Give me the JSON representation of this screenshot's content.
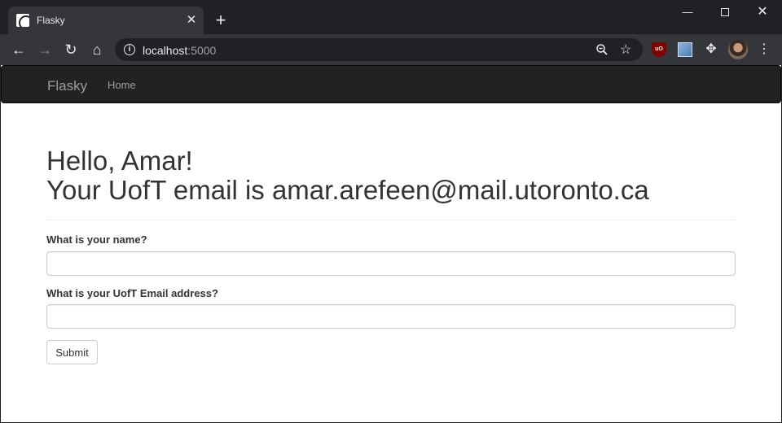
{
  "browser": {
    "tab_title": "Flasky",
    "tab_close": "✕",
    "new_tab": "+",
    "url_host": "localhost",
    "url_port": ":5000",
    "window_controls": {
      "minimize": "—",
      "close": "✕"
    }
  },
  "navbar": {
    "brand": "Flasky",
    "links": [
      "Home"
    ]
  },
  "header": {
    "greeting": "Hello, Amar!",
    "email_line": "Your UofT email is amar.arefeen@mail.utoronto.ca"
  },
  "form": {
    "name_label": "What is your name?",
    "name_value": "",
    "email_label": "What is your UofT Email address?",
    "email_value": "",
    "submit_label": "Submit"
  },
  "colors": {
    "navbar_bg": "#222222",
    "nav_text": "#9d9d9d",
    "heading_text": "#333333",
    "chrome_dark": "#202124",
    "chrome_toolbar": "#35363a"
  }
}
